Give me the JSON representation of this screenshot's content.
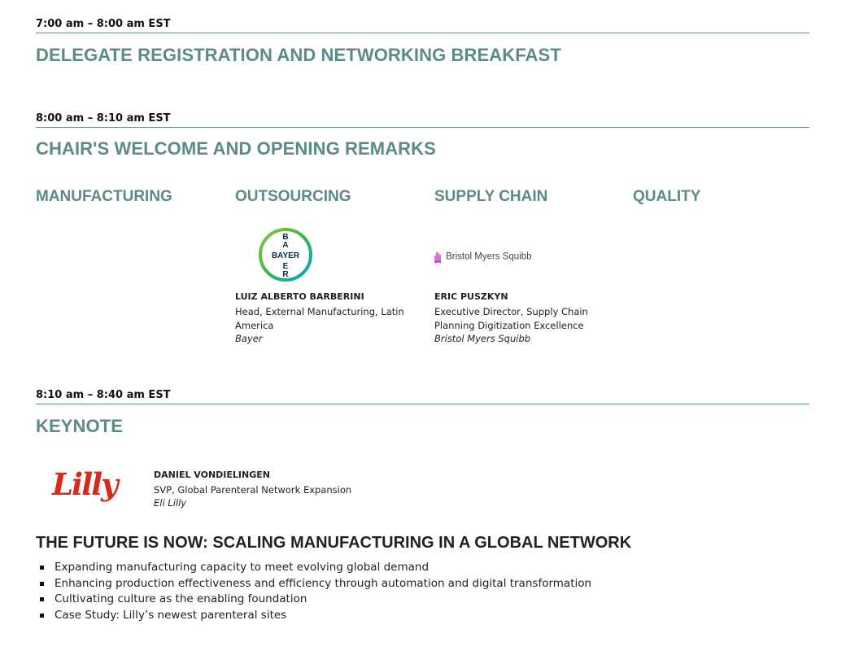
{
  "sessions": [
    {
      "time": "7:00 am – 8:00 am EST",
      "title": "DELEGATE REGISTRATION AND NETWORKING BREAKFAST"
    },
    {
      "time": "8:00 am – 8:10 am EST",
      "title": "CHAIR'S WELCOME AND OPENING REMARKS"
    },
    {
      "time": "8:10 am – 8:40 am EST",
      "title": "KEYNOTE"
    }
  ],
  "tracks": [
    "MANUFACTURING",
    "OUTSOURCING",
    "SUPPLY CHAIN",
    "QUALITY"
  ],
  "chairs": [
    {
      "logo": "bayer-logo",
      "logo_text": "BAYER",
      "name": "LUIZ ALBERTO BARBERINI",
      "role": "Head, External Manufacturing, Latin America",
      "org": "Bayer"
    },
    {
      "logo": "bms-logo",
      "logo_text": "Bristol Myers Squibb",
      "name": "ERIC PUSZKYN",
      "role": "Executive Director, Supply Chain Planning Digitization Excellence",
      "org": "Bristol Myers Squibb"
    }
  ],
  "keynote": {
    "logo": "lilly-logo",
    "logo_text": "Lilly",
    "name": "DANIEL VONDIELINGEN",
    "role": "SVP, Global Parenteral Network Expansion",
    "org": "Eli Lilly",
    "talk_title": "THE FUTURE IS NOW: SCALING MANUFACTURING IN A GLOBAL NETWORK",
    "bullets": [
      "Expanding manufacturing capacity to meet evolving global demand",
      "Enhancing production effectiveness and efficiency through automation and digital transformation",
      "Cultivating culture as the enabling foundation",
      "Case Study: Lilly’s newest parenteral sites"
    ]
  },
  "colors": {
    "accent": "#5b8a87",
    "text": "#222222",
    "lilly_red": "#d52b1e",
    "bms_purple": "#be2bbb"
  }
}
